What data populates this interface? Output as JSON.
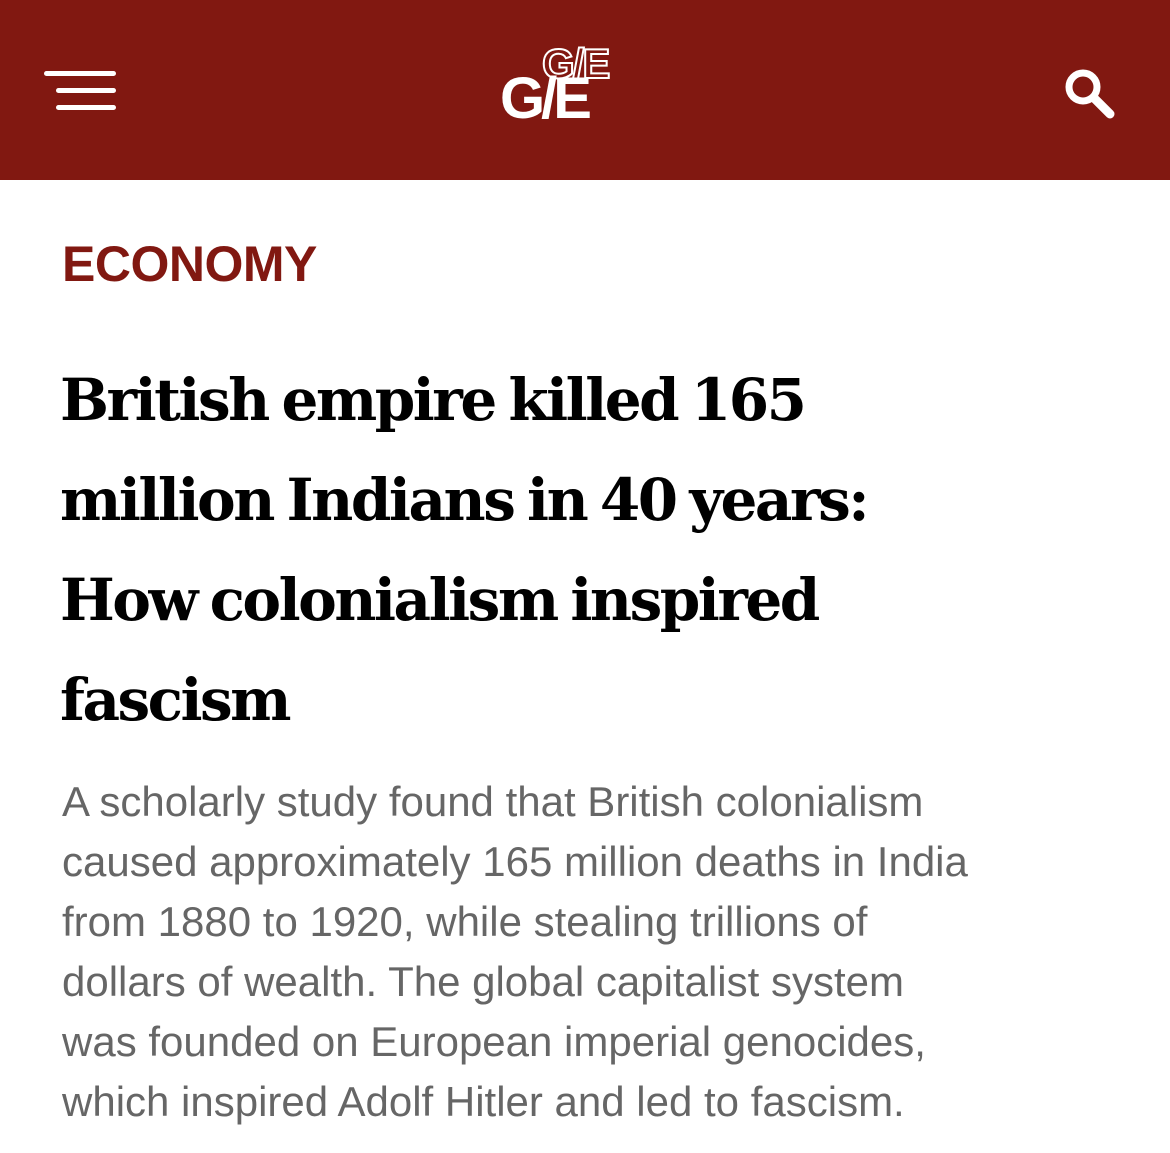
{
  "header": {
    "logo_text": "G/E",
    "menu_icon": "hamburger-menu-icon",
    "search_icon": "search-icon",
    "background_color": "#811811"
  },
  "article": {
    "category": "ECONOMY",
    "category_color": "#811811",
    "headline_lines": [
      "British empire killed 165",
      "million Indians in 40 years:",
      "How colonialism inspired",
      "fascism"
    ],
    "summary_lines": [
      "A scholarly study found that British colonialism",
      "caused approximately 165 million deaths in India",
      "from 1880 to 1920, while stealing trillions of",
      "dollars of wealth. The global capitalist system",
      "was founded on European imperial genocides,",
      "which inspired Adolf Hitler and led to fascism."
    ]
  }
}
